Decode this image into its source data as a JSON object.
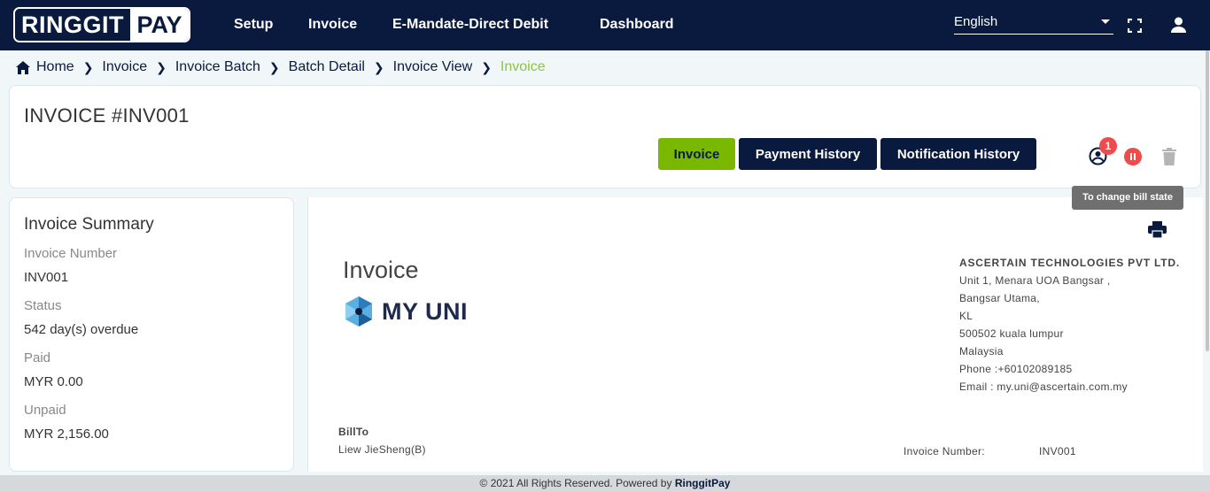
{
  "nav": {
    "logo_part1": "RINGGIT",
    "logo_part2": "PAY",
    "items": [
      "Setup",
      "Invoice",
      "E-Mandate-Direct Debit",
      "Dashboard"
    ],
    "language": "English"
  },
  "breadcrumb": [
    "Home",
    "Invoice",
    "Invoice Batch",
    "Batch Detail",
    "Invoice View",
    "Invoice"
  ],
  "header": {
    "title": "INVOICE #INV001",
    "tabs": [
      "Invoice",
      "Payment History",
      "Notification History"
    ],
    "badge_count": "1",
    "tooltip": "To change bill state"
  },
  "summary": {
    "title": "Invoice Summary",
    "fields": [
      {
        "label": "Invoice Number",
        "value": "INV001"
      },
      {
        "label": "Status",
        "value": "542 day(s) overdue"
      },
      {
        "label": "Paid",
        "value": "MYR 0.00"
      },
      {
        "label": "Unpaid",
        "value": "MYR 2,156.00"
      }
    ]
  },
  "invoice": {
    "heading": "Invoice",
    "brand": "MY UNI",
    "company": {
      "name": "ASCERTAIN TECHNOLOGIES PVT LTD.",
      "lines": [
        "Unit 1, Menara UOA Bangsar ,",
        "Bangsar Utama,",
        "KL",
        "500502 kuala lumpur",
        "Malaysia",
        "Phone :+60102089185",
        "Email : my.uni@ascertain.com.my"
      ]
    },
    "bill_to_label": "BillTo",
    "bill_to_name": "Liew JieSheng(B)",
    "meta_label": "Invoice Number:",
    "meta_value": "INV001"
  },
  "footer": {
    "text": "© 2021 All Rights Reserved. Powered by ",
    "brand": "RinggitPay"
  },
  "colors": {
    "navy": "#0a1a3f",
    "accent_green": "#7ab800",
    "danger_red": "#f04a4a"
  }
}
